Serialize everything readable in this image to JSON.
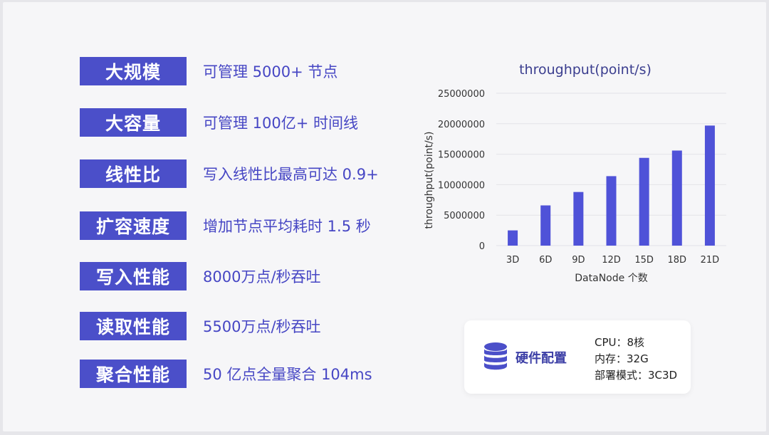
{
  "features": [
    {
      "label": "大规模",
      "desc": "可管理 5000+ 节点"
    },
    {
      "label": "大容量",
      "desc": "可管理 100亿+ 时间线"
    },
    {
      "label": "线性比",
      "desc": "写入线性比最高可达 0.9+"
    },
    {
      "label": "扩容速度",
      "desc": "增加节点平均耗时 1.5 秒"
    },
    {
      "label": "写入性能",
      "desc": "8000万点/秒吞吐"
    },
    {
      "label": "读取性能",
      "desc": "5500万点/秒吞吐"
    },
    {
      "label": "聚合性能",
      "desc": "50 亿点全量聚合 104ms"
    }
  ],
  "colors": {
    "accent": "#4b4fc9",
    "bar": "#4f52d8",
    "text_accent": "#4646c4"
  },
  "chart_data": {
    "type": "bar",
    "title": "throughput(point/s)",
    "xlabel": "DataNode 个数",
    "ylabel": "throughput(point/s)",
    "categories": [
      "3D",
      "6D",
      "9D",
      "12D",
      "15D",
      "18D",
      "21D"
    ],
    "values": [
      2500000,
      6600000,
      8800000,
      11400000,
      14400000,
      15600000,
      19700000
    ],
    "ylim": [
      0,
      25000000
    ],
    "yticks": [
      0,
      5000000,
      10000000,
      15000000,
      20000000,
      25000000
    ],
    "grid": true
  },
  "hardware": {
    "icon": "database-icon",
    "label": "硬件配置",
    "specs": [
      "CPU：8核",
      "内存：32G",
      "部署模式：3C3D"
    ]
  }
}
